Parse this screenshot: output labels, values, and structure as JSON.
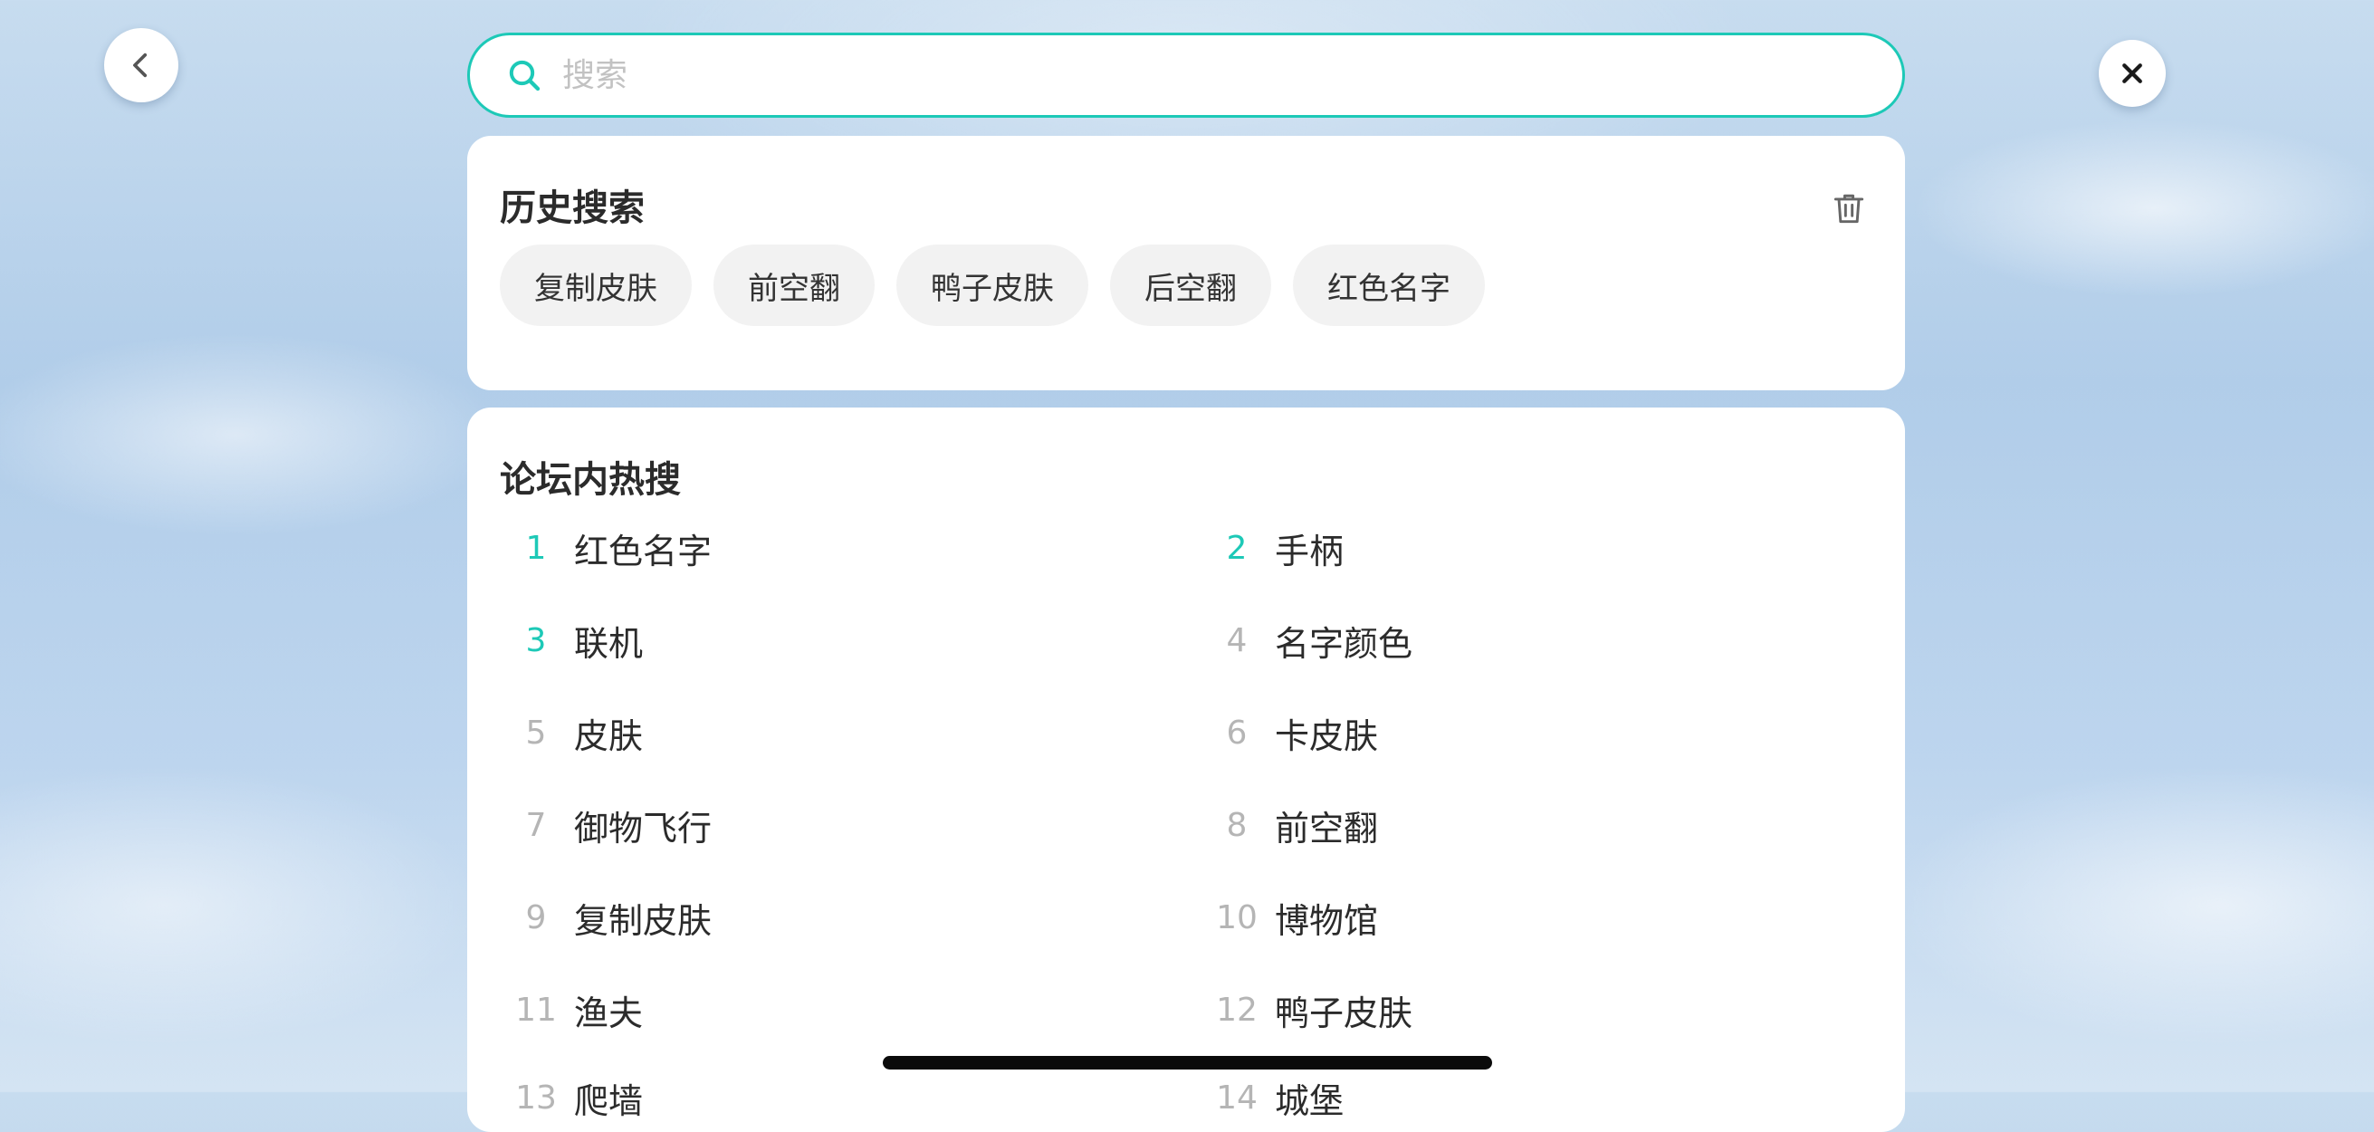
{
  "nav": {
    "back_icon": "chevron-left-icon",
    "close_icon": "close-icon"
  },
  "search": {
    "placeholder": "搜索",
    "value": "",
    "icon": "search-icon",
    "accent_color": "#1dc9b7"
  },
  "history": {
    "title": "历史搜索",
    "clear_icon": "trash-icon",
    "items": [
      "复制皮肤",
      "前空翻",
      "鸭子皮肤",
      "后空翻",
      "红色名字"
    ]
  },
  "hot": {
    "title": "论坛内热搜",
    "highlight_color": "#1dc9b7",
    "items": [
      {
        "rank": "1",
        "label": "红色名字"
      },
      {
        "rank": "2",
        "label": "手柄"
      },
      {
        "rank": "3",
        "label": "联机"
      },
      {
        "rank": "4",
        "label": "名字颜色"
      },
      {
        "rank": "5",
        "label": "皮肤"
      },
      {
        "rank": "6",
        "label": "卡皮肤"
      },
      {
        "rank": "7",
        "label": "御物飞行"
      },
      {
        "rank": "8",
        "label": "前空翻"
      },
      {
        "rank": "9",
        "label": "复制皮肤"
      },
      {
        "rank": "10",
        "label": "博物馆"
      },
      {
        "rank": "11",
        "label": "渔夫"
      },
      {
        "rank": "12",
        "label": "鸭子皮肤"
      },
      {
        "rank": "13",
        "label": "爬墙"
      },
      {
        "rank": "14",
        "label": "城堡"
      }
    ]
  }
}
